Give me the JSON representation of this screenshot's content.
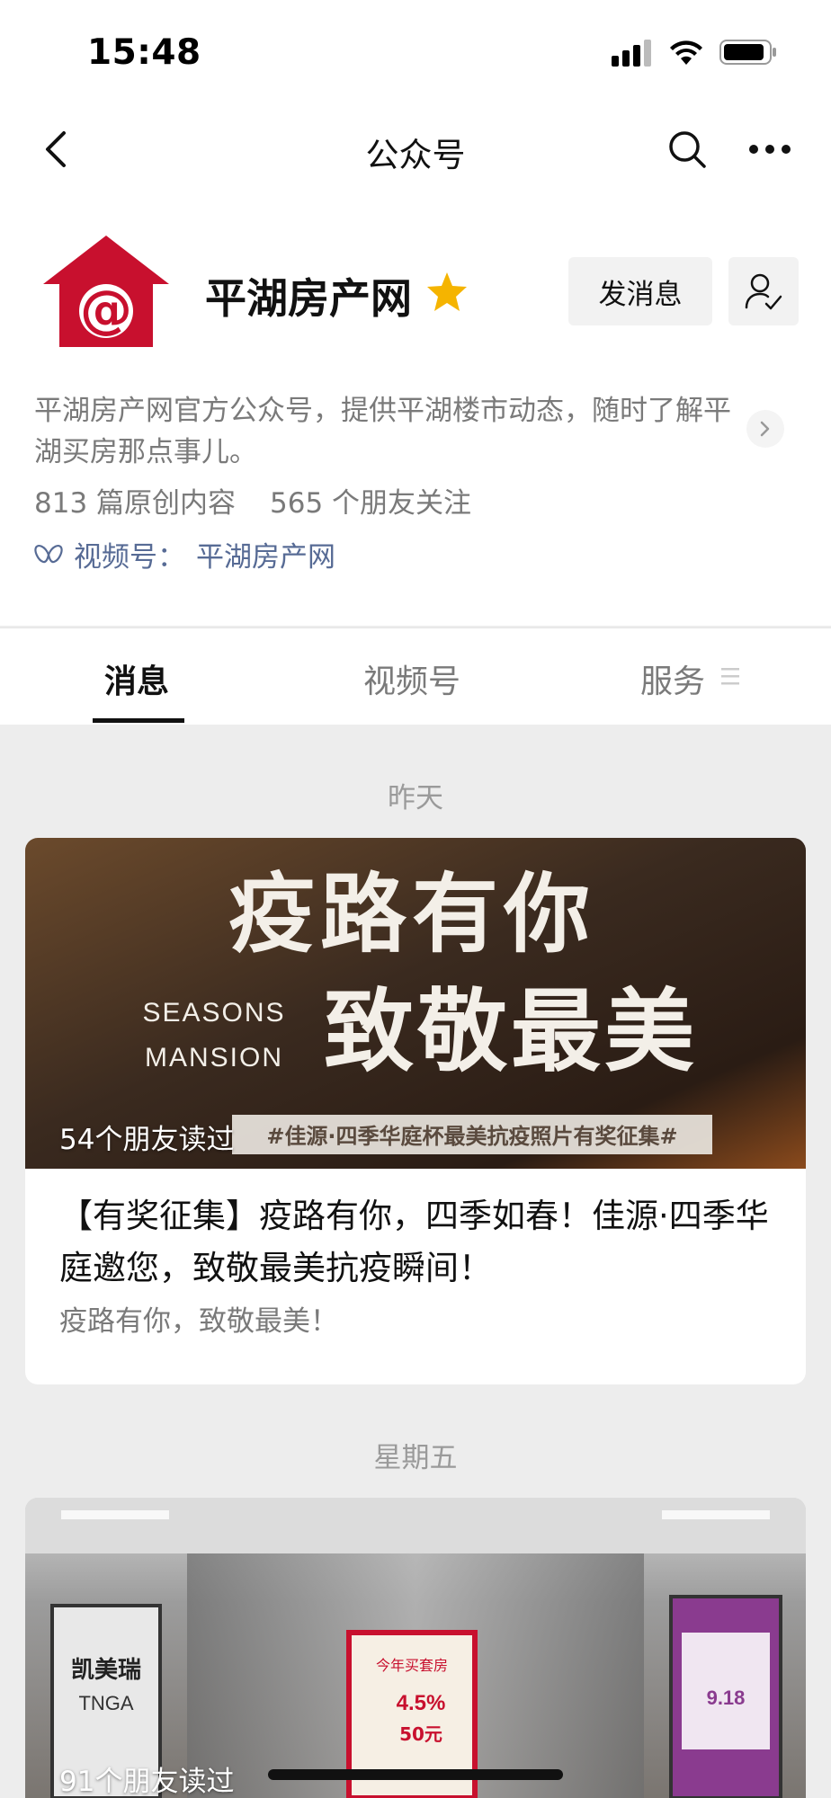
{
  "status_bar": {
    "time": "15:48"
  },
  "nav": {
    "title": "公众号",
    "back_icon": "chevron-left-icon",
    "search_icon": "search-icon",
    "more_icon": "more-dots-icon"
  },
  "account": {
    "name": "平湖房产网",
    "logo_symbol": "@",
    "send_message_label": "发消息",
    "description": "平湖房产网官方公众号，提供平湖楼市动态，随时了解平湖买房那点事儿。",
    "original_count": "813 篇原创内容",
    "friends_follow": "565 个朋友关注",
    "channel_label": "视频号：",
    "channel_name": "平湖房产网",
    "colors": {
      "brand_red": "#c8102e",
      "link_blue": "#576b95",
      "star": "#f5b400"
    }
  },
  "tabs": [
    {
      "label": "消息",
      "active": true
    },
    {
      "label": "视频号",
      "active": false
    },
    {
      "label": "服务",
      "active": false
    }
  ],
  "feed": [
    {
      "day": "昨天",
      "cover": {
        "headline_1": "疫路有你",
        "brand_1": "SEASONS",
        "brand_2": "MANSION",
        "headline_2": "致敬最美",
        "banner": "#佳源·四季华庭杯最美抗疫照片有奖征集#"
      },
      "read_count": "54个朋友读过",
      "title": "【有奖征集】疫路有你，四季如春！佳源·四季华庭邀您，致敬最美抗疫瞬间！",
      "subtitle": "疫路有你，致敬最美！"
    },
    {
      "day": "星期五",
      "cover": {
        "left_ad_line_1": "凯美瑞",
        "left_ad_line_2": "TNGA",
        "center_ad_title": "今年买套房",
        "center_ad_rate": "4.5%",
        "center_ad_price": "50元",
        "right_ad_price": "9.18"
      },
      "read_count": "91个朋友读过"
    }
  ]
}
